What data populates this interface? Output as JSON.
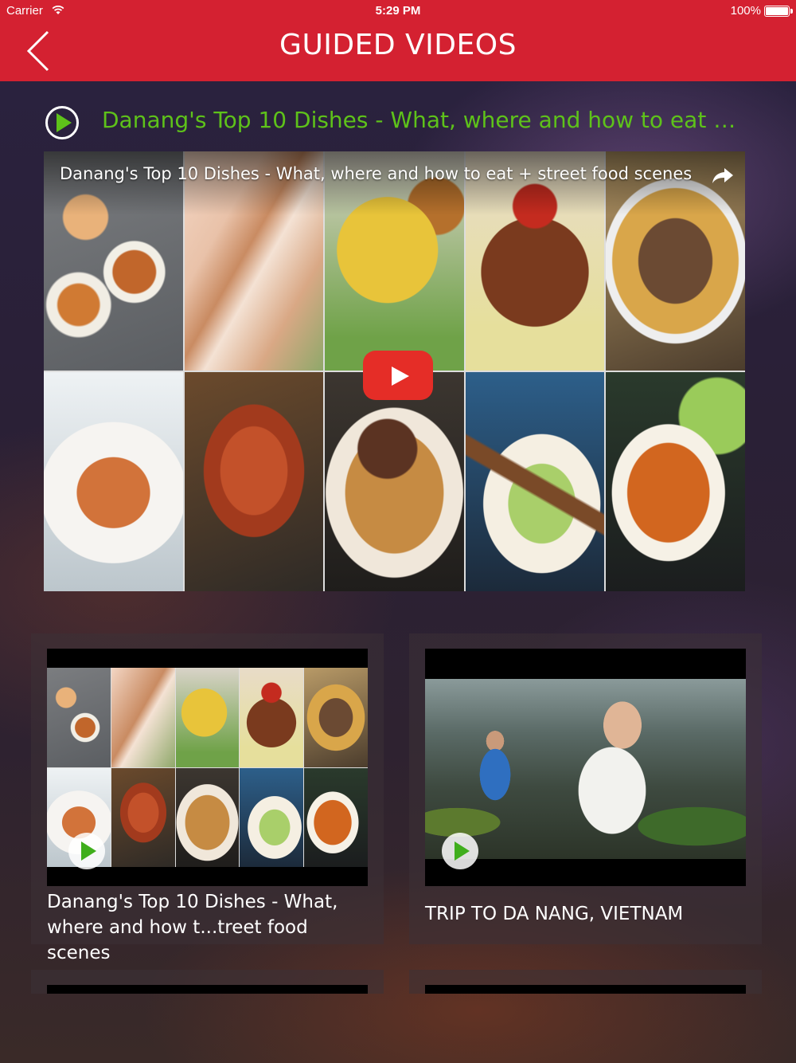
{
  "status_bar": {
    "carrier": "Carrier",
    "time": "5:29 PM",
    "battery": "100%"
  },
  "header": {
    "title": "GUIDED VIDEOS",
    "color": "#d42131"
  },
  "featured": {
    "title": "Danang's Top 10 Dishes - What, where and how to eat + stre...",
    "player_title": "Danang's Top 10 Dishes - What, where and how to eat + street food scenes",
    "title_color": "#5ec21a"
  },
  "videos": [
    {
      "title_line1": "Danang's Top 10 Dishes - What,",
      "title_line2": "where and how t...treet food scenes"
    },
    {
      "title_line1": "TRIP TO DA NANG, VIETNAM",
      "title_line2": ""
    }
  ],
  "icons": {
    "back": "chevron-left-icon",
    "play": "play-circle-icon",
    "share": "share-icon",
    "wifi": "wifi-icon",
    "battery": "battery-icon",
    "youtube_play": "youtube-play-icon"
  }
}
